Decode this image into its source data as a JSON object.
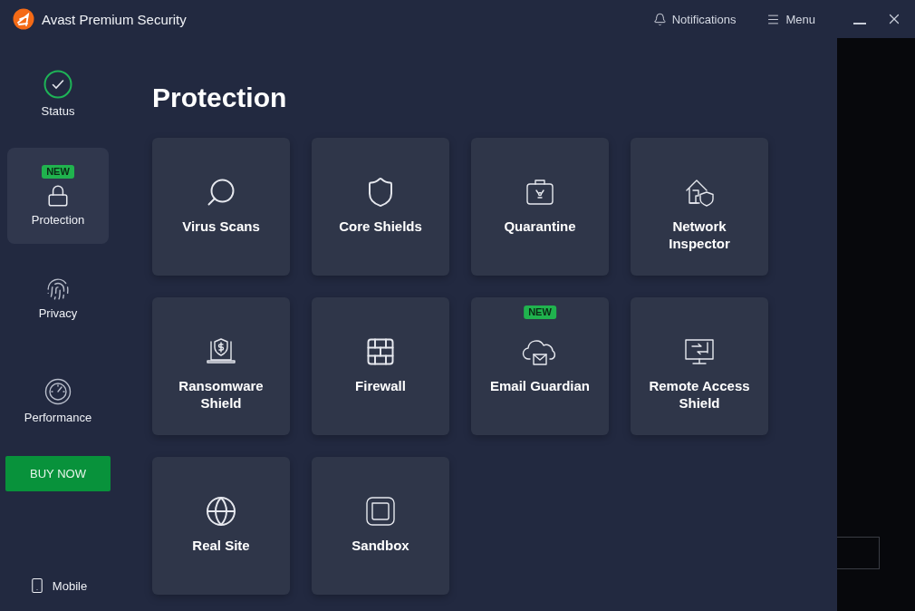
{
  "window": {
    "title": "Avast Premium Security",
    "notifications": "Notifications",
    "menu": "Menu"
  },
  "sidebar": {
    "items": [
      {
        "kind": "status",
        "label": "Status",
        "selected": false
      },
      {
        "kind": "protection",
        "label": "Protection",
        "selected": true,
        "badge": "NEW"
      },
      {
        "kind": "privacy",
        "label": "Privacy",
        "selected": false
      },
      {
        "kind": "performance",
        "label": "Performance",
        "selected": false
      }
    ],
    "buy_button": "BUY NOW",
    "mobile": "Mobile"
  },
  "page": {
    "title": "Protection",
    "tiles": [
      {
        "kind": "scan",
        "label": "Virus Scans"
      },
      {
        "kind": "shield",
        "label": "Core Shields"
      },
      {
        "kind": "quarantine",
        "label": "Quarantine"
      },
      {
        "kind": "network",
        "label": "Network Inspector"
      },
      {
        "kind": "ransomware",
        "label": "Ransomware Shield"
      },
      {
        "kind": "firewall",
        "label": "Firewall"
      },
      {
        "kind": "email",
        "label": "Email Guardian",
        "badge": "NEW"
      },
      {
        "kind": "remote",
        "label": "Remote Access Shield"
      },
      {
        "kind": "globe",
        "label": "Real Site"
      },
      {
        "kind": "sandbox",
        "label": "Sandbox"
      }
    ]
  }
}
